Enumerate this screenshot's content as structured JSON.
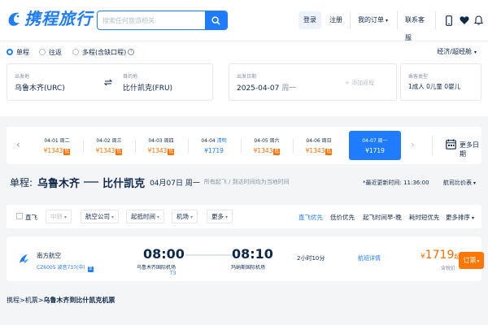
{
  "header": {
    "logo_text": "携程旅行",
    "search_placeholder": "搜索任何旅游相关",
    "nav": {
      "login": "登录",
      "register": "注册",
      "my_orders": "我的订单",
      "customer_service": "联系客服"
    }
  },
  "search_panel": {
    "trip_types": [
      "单程",
      "往返",
      "多程(含缺口程)"
    ],
    "selected_trip": "单程",
    "cabin_class": "经济/超经舱",
    "departure": {
      "label": "出发地",
      "value": "乌鲁木齐(URC)"
    },
    "arrival": {
      "label": "目的地",
      "value": "比什凯克(FRU)"
    },
    "depart_date": {
      "label": "出发日期",
      "date": "2025-04-07",
      "weekday": "周一"
    },
    "add_return": "+ 添加返程",
    "passengers": {
      "label": "乘客类型",
      "value": "1成人  0儿童  0婴儿"
    }
  },
  "date_strip": {
    "days": [
      {
        "date": "04-01",
        "weekday": "周二",
        "price": "¥1343",
        "low": "低",
        "state": "normal"
      },
      {
        "date": "04-02",
        "weekday": "周三",
        "price": "¥1343",
        "low": "低",
        "state": "normal"
      },
      {
        "date": "04-03",
        "weekday": "周四",
        "price": "¥1343",
        "low": "低",
        "state": "normal"
      },
      {
        "date": "04-04",
        "weekday": "清明",
        "price": "¥1719",
        "low": "",
        "state": "blue"
      },
      {
        "date": "04-05",
        "weekday": "周六",
        "price": "¥1343",
        "low": "低",
        "state": "normal"
      },
      {
        "date": "04-06",
        "weekday": "周日",
        "price": "¥1343",
        "low": "低",
        "state": "normal"
      },
      {
        "date": "04-07",
        "weekday": "周一",
        "price": "¥1719",
        "low": "",
        "state": "active"
      }
    ],
    "more_dates": "更多日期"
  },
  "route_summary": {
    "trip_label": "单程:",
    "from": "乌鲁木齐",
    "to": "比什凯克",
    "date": "04月07日 周一",
    "hint": "所有起飞 / 到达时间均为当地时间",
    "last_update": "*最近更新时间: 11:36:00",
    "price_calendar": "航司比价表"
  },
  "filters": {
    "direct": "直飞",
    "items": [
      "中转",
      "航空公司",
      "起抵时间",
      "机场",
      "更多"
    ],
    "sorts": [
      "直飞优先",
      "低价优先",
      "起飞时间早-晚",
      "耗时短优先",
      "更多排序"
    ]
  },
  "flight": {
    "airline": "南方航空",
    "flight_no": "CZ6005 波音737(中)",
    "share_tag": "享",
    "dep_time": "08:00",
    "dep_airport": "乌鲁木齐国际机场",
    "dep_terminal": "T3",
    "arr_time": "08:10",
    "arr_airport": "玛纳斯国际机场",
    "duration": "2小时10分",
    "detail": "航班详情",
    "price": "1719",
    "currency": "¥",
    "price_suffix": "起",
    "tax_note": "含税价",
    "book": "订票"
  },
  "breadcrumb": {
    "items": [
      "携程",
      "机票"
    ],
    "current": "乌鲁木齐到比什凯克机票"
  },
  "colors": {
    "brand": "#1f7cff",
    "price": "#ff6f00",
    "book": "#ff7700"
  }
}
